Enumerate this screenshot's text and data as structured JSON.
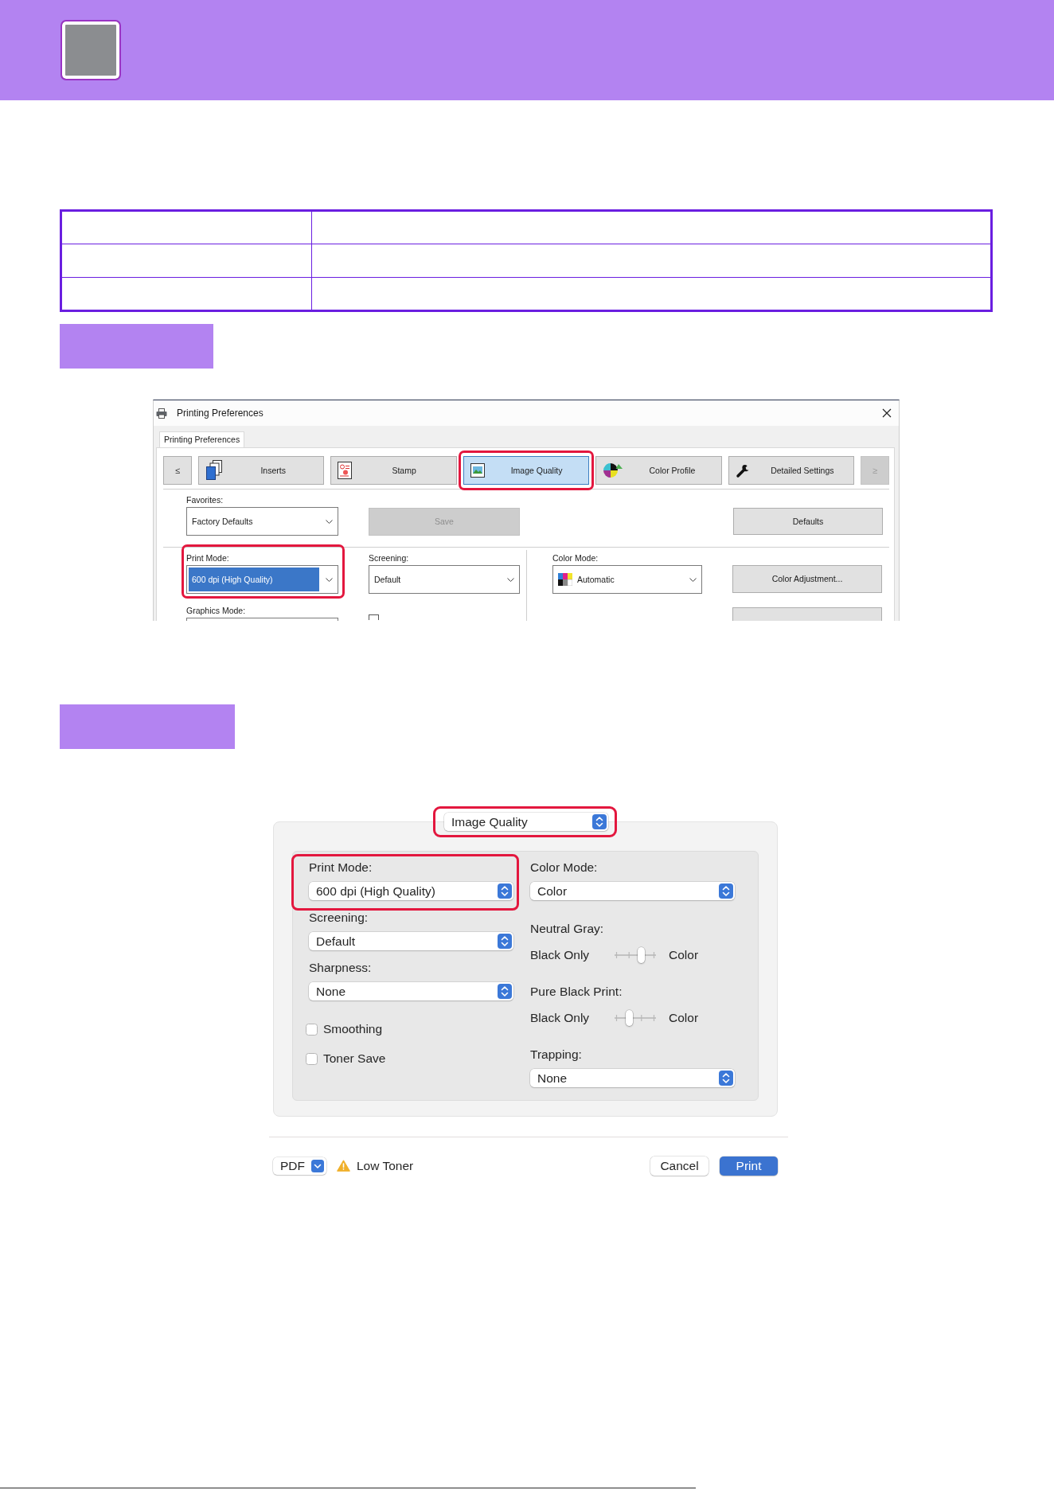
{
  "windows_dialog": {
    "title": "Printing Preferences",
    "tabs": [
      {
        "label": "Printing Preferences",
        "selected": true
      }
    ],
    "categories": [
      {
        "kind": "scroll",
        "label": "≤",
        "disabled": false
      },
      {
        "kind": "category",
        "label": "Inserts",
        "selected": false,
        "highlighted": false
      },
      {
        "kind": "category",
        "label": "Stamp",
        "selected": false,
        "highlighted": false
      },
      {
        "kind": "category",
        "label": "Image Quality",
        "selected": true,
        "highlighted": true
      },
      {
        "kind": "category",
        "label": "Color Profile",
        "selected": false,
        "highlighted": false
      },
      {
        "kind": "category",
        "label": "Detailed Settings",
        "selected": false,
        "highlighted": false
      },
      {
        "kind": "scroll",
        "label": "≥",
        "disabled": true
      }
    ],
    "favorites": {
      "label": "Favorites:",
      "value": "Factory Defaults",
      "focused": false,
      "highlighted": false
    },
    "save_button": {
      "label": "Save",
      "disabled": true
    },
    "defaults_button": {
      "label": "Defaults",
      "disabled": false
    },
    "print_mode": {
      "label": "Print Mode:",
      "value": "600 dpi (High Quality)",
      "focused": true,
      "highlighted": true
    },
    "screening": {
      "label": "Screening:",
      "value": "Default",
      "focused": false,
      "highlighted": false
    },
    "color_mode": {
      "label": "Color Mode:",
      "value": "Automatic",
      "focused": false,
      "highlighted": false
    },
    "color_adjustment_button": {
      "label": "Color Adjustment...",
      "disabled": false
    },
    "graphics_mode": {
      "label": "Graphics Mode:"
    },
    "smoothing": {
      "checked": false
    }
  },
  "mac_dialog": {
    "panel_menu": {
      "value": "Image Quality",
      "highlighted": true
    },
    "left": [
      {
        "kind": "popup",
        "label": "Print Mode:",
        "value": "600 dpi (High Quality)",
        "highlighted": true
      },
      {
        "kind": "popup",
        "label": "Screening:",
        "value": "Default",
        "highlighted": false
      },
      {
        "kind": "popup",
        "label": "Sharpness:",
        "value": "None",
        "highlighted": false
      },
      {
        "kind": "checkbox",
        "label": "Smoothing",
        "checked": false
      },
      {
        "kind": "checkbox",
        "label": "Toner Save",
        "checked": false
      }
    ],
    "right": [
      {
        "kind": "popup",
        "label": "Color Mode:",
        "value": "Color",
        "highlighted": false
      },
      {
        "kind": "slider",
        "label": "Neutral Gray:",
        "start_label": "Black Only",
        "end_label": "Color",
        "level": 0.667
      },
      {
        "kind": "slider",
        "label": "Pure Black Print:",
        "start_label": "Black Only",
        "end_label": "Color",
        "level": 0.333
      },
      {
        "kind": "popup",
        "label": "Trapping:",
        "value": "None",
        "highlighted": false
      }
    ],
    "pdf_menu": "PDF",
    "warning": "Low Toner",
    "buttons": [
      {
        "label": "Cancel",
        "kind": "secondary"
      },
      {
        "label": "Print",
        "kind": "default"
      }
    ]
  }
}
